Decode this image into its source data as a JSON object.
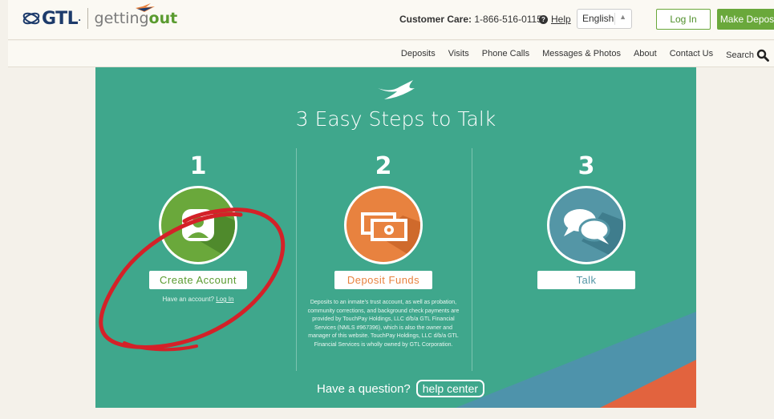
{
  "header": {
    "brand": "GTL",
    "brand_suffix": ".",
    "product_prefix": "getting",
    "product_suffix": "out",
    "customer_care_label": "Customer Care:",
    "customer_care_phone": "1-866-516-0115",
    "help_label": "Help",
    "language_selected": "English",
    "login_label": "Log In",
    "deposit_label": "Make Deposit"
  },
  "nav": {
    "items": [
      "Deposits",
      "Visits",
      "Phone Calls",
      "Messages & Photos",
      "About",
      "Contact Us"
    ],
    "search_label": "Search"
  },
  "hero": {
    "title": "3 Easy Steps to Talk",
    "steps": [
      {
        "number": "1",
        "button_label": "Create Account",
        "icon": "user-icon"
      },
      {
        "number": "2",
        "button_label": "Deposit Funds",
        "icon": "money-icon"
      },
      {
        "number": "3",
        "button_label": "Talk",
        "icon": "chat-bubbles-icon"
      }
    ],
    "have_account_text": "Have an account?",
    "have_account_link": "Log In",
    "disclaimer": "Deposits to an inmate's trust account, as well as probation, community corrections, and background check payments are provided by TouchPay Holdings, LLC d/b/a GTL Financial Services (NMLS #967396), which is also the owner and manager of this website. TouchPay Holdings, LLC d/b/a GTL Financial Services is wholly owned by GTL Corporation.",
    "question_text": "Have a question?",
    "help_center_label": "help center"
  },
  "colors": {
    "hero_bg": "#3fa78c",
    "green": "#6aa83b",
    "orange": "#e8823f",
    "blue_gray": "#5496a6",
    "annotation_red": "#d42128"
  }
}
